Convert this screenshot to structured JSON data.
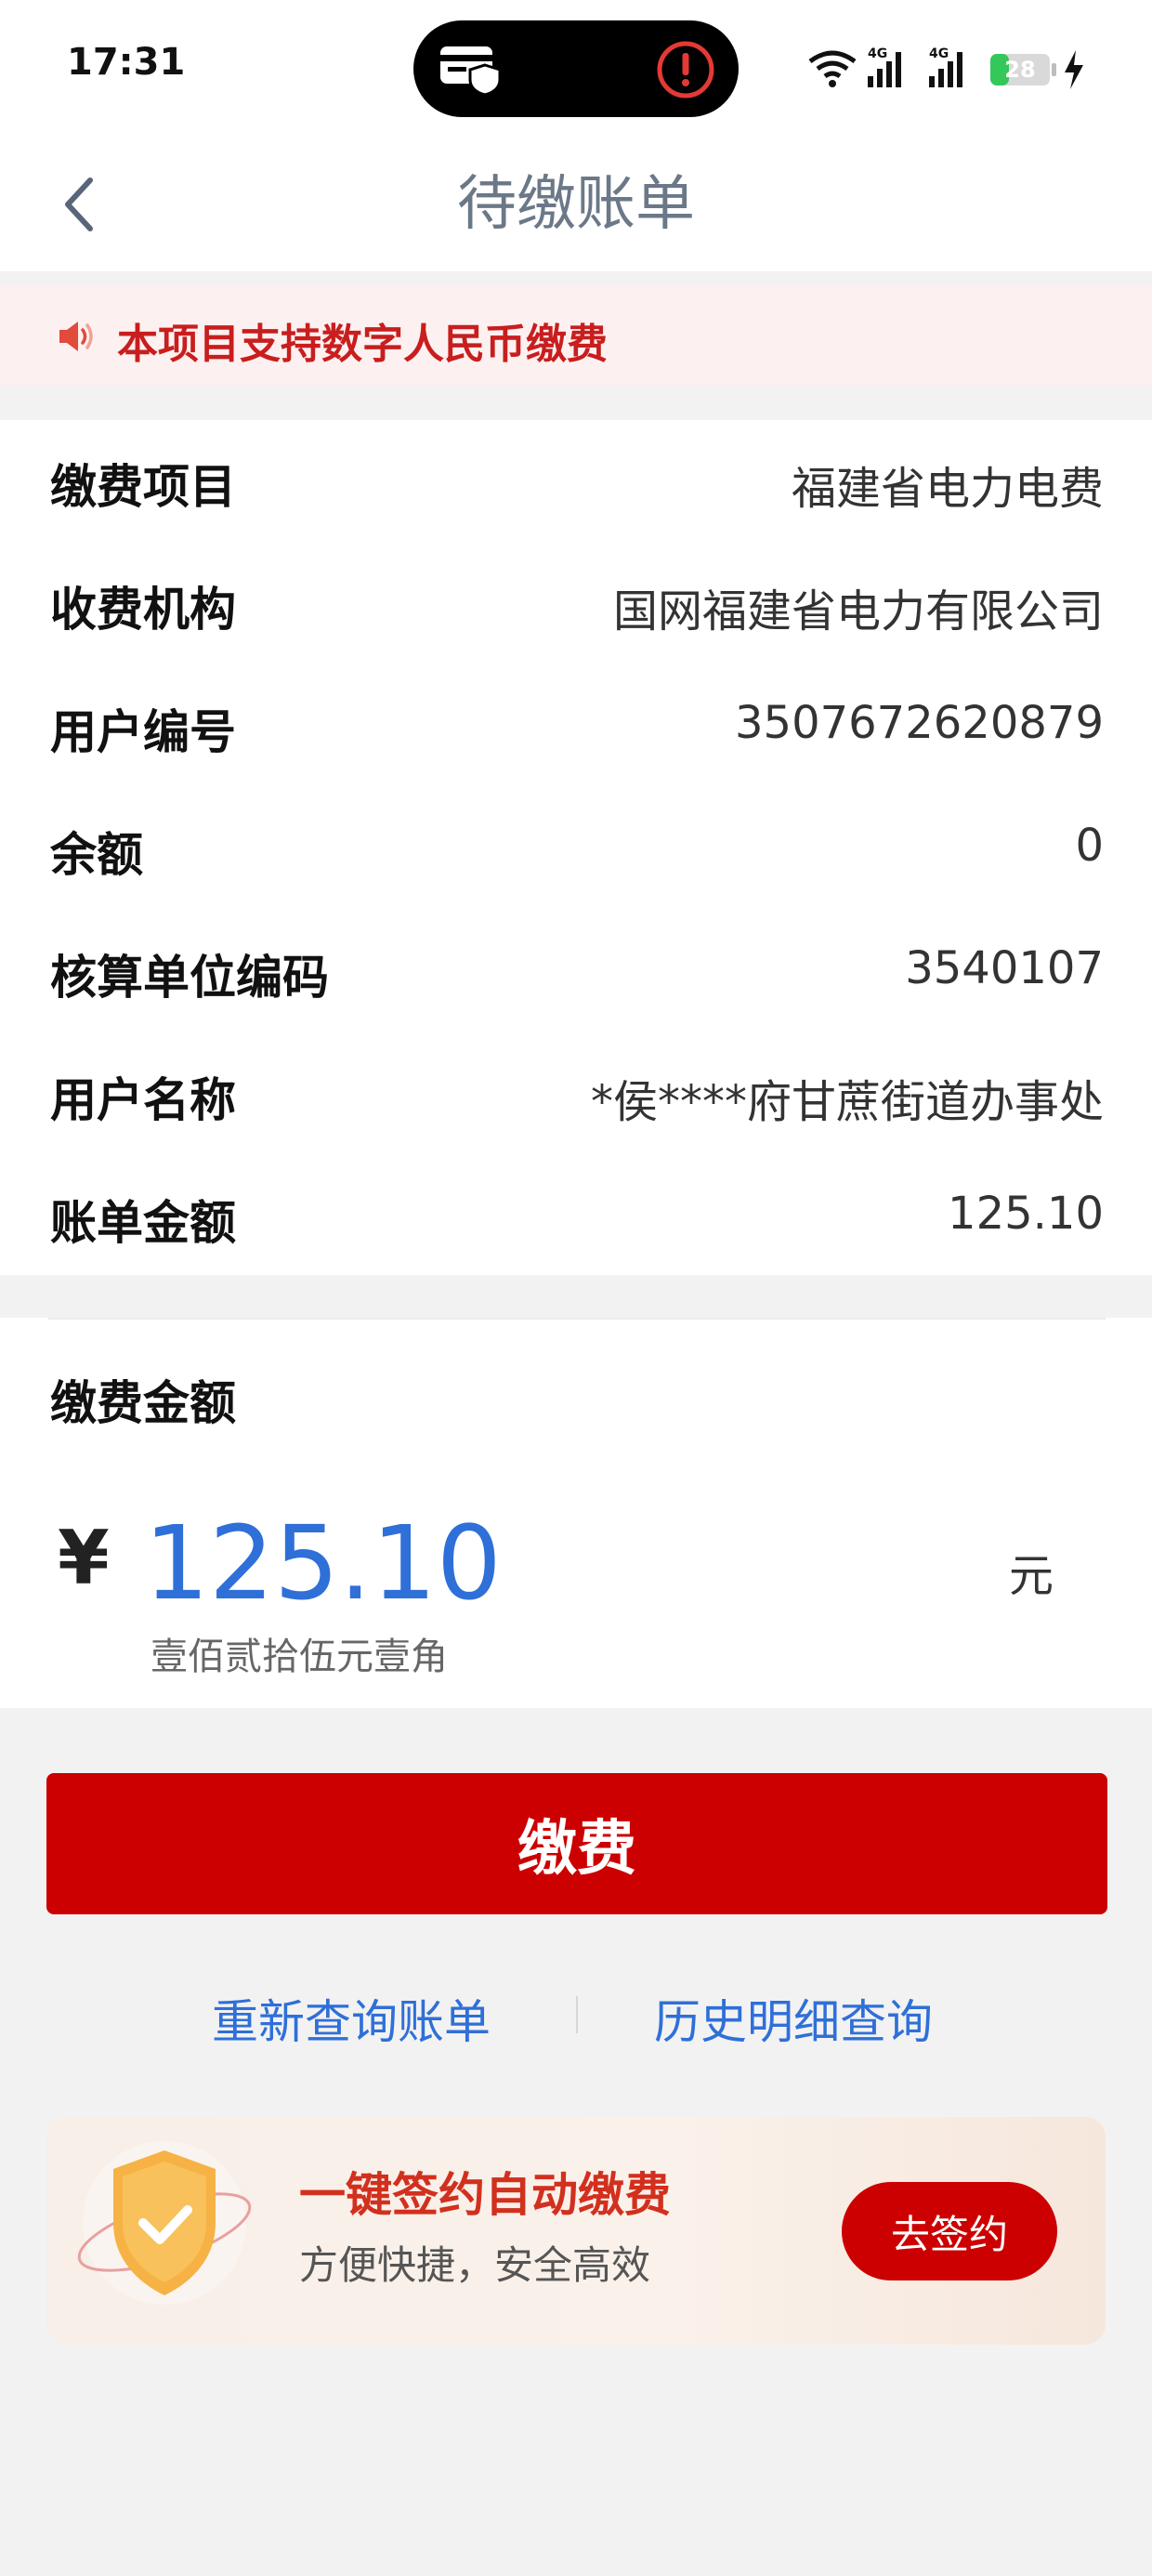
{
  "status_bar": {
    "time": "17:31",
    "battery": "28"
  },
  "nav": {
    "title": "待缴账单"
  },
  "notice": {
    "text": "本项目支持数字人民币缴费"
  },
  "info_rows": [
    {
      "label": "缴费项目",
      "value": "福建省电力电费"
    },
    {
      "label": "收费机构",
      "value": "国网福建省电力有限公司"
    },
    {
      "label": "用户编号",
      "value": "3507672620879"
    },
    {
      "label": "余额",
      "value": "0"
    },
    {
      "label": "核算单位编码",
      "value": "3540107"
    },
    {
      "label": "用户名称",
      "value": "*侯****府甘蔗街道办事处"
    },
    {
      "label": "账单金额",
      "value": "125.10"
    }
  ],
  "payment": {
    "label": "缴费金额",
    "currency_symbol": "¥",
    "amount": "125.10",
    "unit": "元",
    "amount_in_words": "壹佰贰拾伍元壹角"
  },
  "pay_button": {
    "label": "缴费"
  },
  "links": {
    "requery": "重新查询账单",
    "history": "历史明细查询"
  },
  "promo": {
    "title": "一键签约自动缴费",
    "subtitle": "方便快捷，安全高效",
    "button": "去签约"
  },
  "colors": {
    "primary_red": "#cc0000",
    "link_blue": "#2f6fd8",
    "notice_red": "#c81e1e",
    "battery_green": "#34c759"
  },
  "icons": {
    "back": "chevron-left-icon",
    "speaker": "speaker-icon",
    "card": "card-shield-icon",
    "alert": "alert-icon",
    "shield": "shield-check-icon"
  }
}
